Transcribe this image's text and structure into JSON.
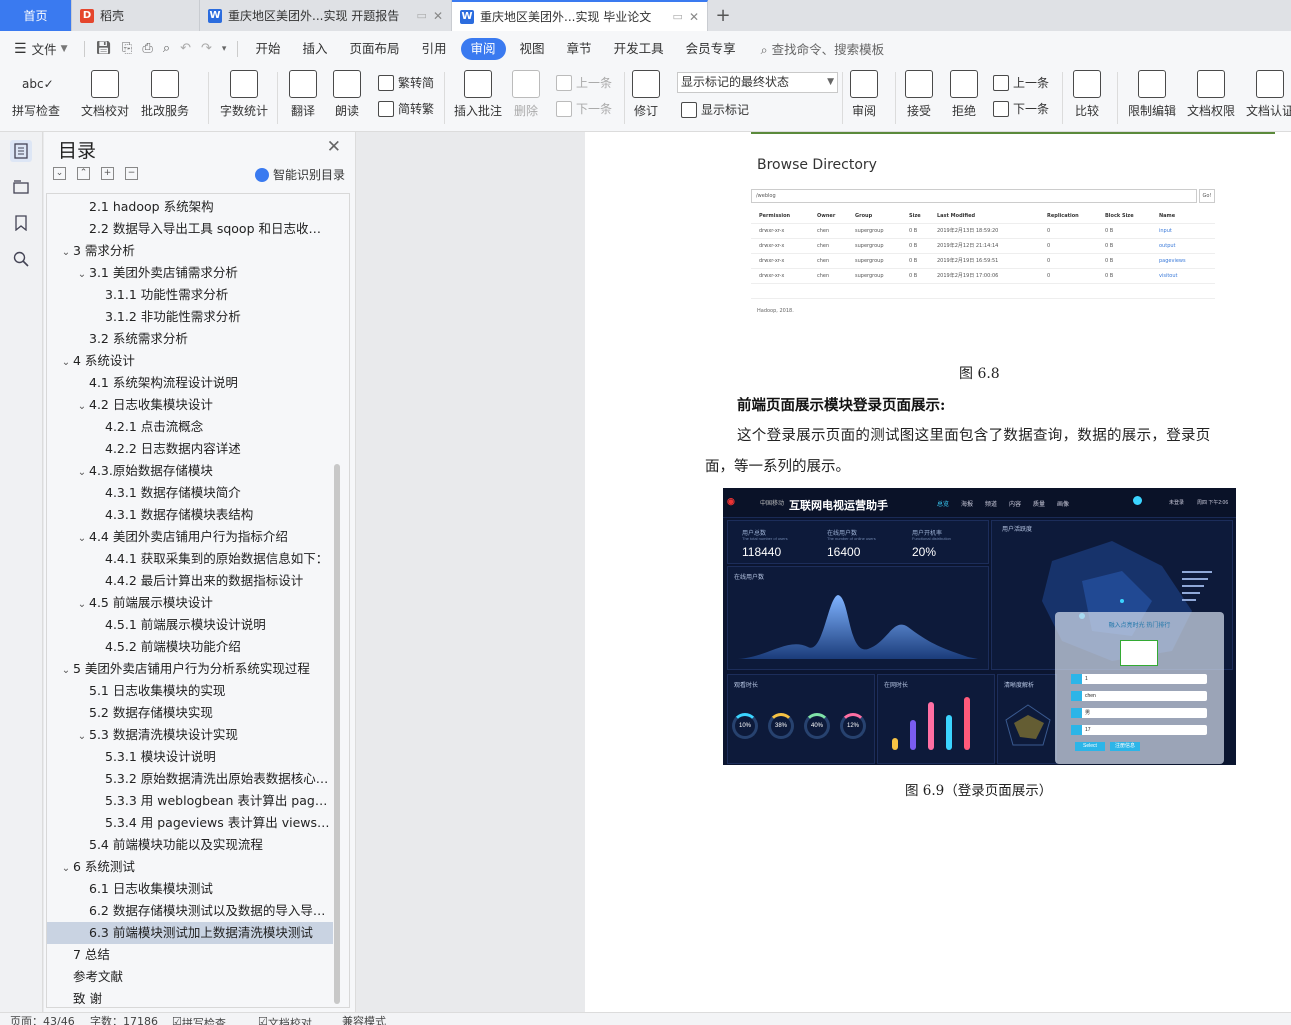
{
  "tabs": {
    "home": "首页",
    "daoke": "稻壳",
    "doc1": "重庆地区美团外...实现 开题报告",
    "doc2": "重庆地区美团外...实现 毕业论文"
  },
  "menu": {
    "file": "文件",
    "items": [
      "开始",
      "插入",
      "页面布局",
      "引用",
      "审阅",
      "视图",
      "章节",
      "开发工具",
      "会员专享"
    ],
    "active": "审阅",
    "search": "查找命令、搜索模板"
  },
  "ribbon": {
    "spell": "拼写检查",
    "doccheck": "文档校对",
    "annotate_service": "批改服务",
    "wordcount": "字数统计",
    "translate": "翻译",
    "read": "朗读",
    "fan2jian": "繁转简",
    "jian2fan": "简转繁",
    "insert_comment": "插入批注",
    "delete": "删除",
    "prev": "上一条",
    "next": "下一条",
    "revise": "修订",
    "markup_select": "显示标记的最终状态",
    "show_markup": "显示标记",
    "review": "审阅",
    "accept": "接受",
    "reject": "拒绝",
    "prev2": "上一条",
    "next2": "下一条",
    "compare": "比较",
    "restrict": "限制编辑",
    "permission": "文档权限",
    "certify": "文档认证"
  },
  "toc": {
    "title": "目录",
    "smart": "智能识别目录",
    "items": [
      {
        "text": "2.1 hadoop 系统架构",
        "level": 2,
        "arrow": ""
      },
      {
        "text": "2.2  数据导入导出工具 sqoop 和日志收集工具 flume",
        "level": 2,
        "arrow": ""
      },
      {
        "text": "3  需求分析",
        "level": 1,
        "arrow": "v"
      },
      {
        "text": "3.1  美团外卖店铺需求分析",
        "level": 2,
        "arrow": "v"
      },
      {
        "text": "3.1.1  功能性需求分析",
        "level": 3,
        "arrow": ""
      },
      {
        "text": "3.1.2  非功能性需求分析",
        "level": 3,
        "arrow": ""
      },
      {
        "text": "3.2  系统需求分析",
        "level": 2,
        "arrow": ""
      },
      {
        "text": "4  系统设计",
        "level": 1,
        "arrow": "v"
      },
      {
        "text": "4.1  系统架构流程设计说明",
        "level": 2,
        "arrow": ""
      },
      {
        "text": "4.2  日志收集模块设计",
        "level": 2,
        "arrow": "v"
      },
      {
        "text": "4.2.1  点击流概念",
        "level": 3,
        "arrow": ""
      },
      {
        "text": "4.2.2  日志数据内容详述",
        "level": 3,
        "arrow": ""
      },
      {
        "text": "4.3.原始数据存储模块",
        "level": 2,
        "arrow": "v"
      },
      {
        "text": "4.3.1 数据存储模块简介",
        "level": 3,
        "arrow": ""
      },
      {
        "text": "4.3.1  数据存储模块表结构",
        "level": 3,
        "arrow": ""
      },
      {
        "text": "4.4  美团外卖店铺用户行为指标介绍",
        "level": 2,
        "arrow": "v"
      },
      {
        "text": "4.4.1  获取采集到的原始数据信息如下：",
        "level": 3,
        "arrow": ""
      },
      {
        "text": "4.4.2  最后计算出来的数据指标设计",
        "level": 3,
        "arrow": ""
      },
      {
        "text": "4.5  前端展示模块设计",
        "level": 2,
        "arrow": "v"
      },
      {
        "text": "4.5.1  前端展示模块设计说明",
        "level": 3,
        "arrow": ""
      },
      {
        "text": "4.5.2  前端模块功能介绍",
        "level": 3,
        "arrow": ""
      },
      {
        "text": "5  美团外卖店铺用户行为分析系统实现过程",
        "level": 1,
        "arrow": "v"
      },
      {
        "text": "5.1  日志收集模块的实现",
        "level": 2,
        "arrow": ""
      },
      {
        "text": "5.2  数据存储模块实现",
        "level": 2,
        "arrow": ""
      },
      {
        "text": "5.3  数据清洗模块设计实现",
        "level": 2,
        "arrow": "v"
      },
      {
        "text": "5.3.1  模块设计说明",
        "level": 3,
        "arrow": ""
      },
      {
        "text": "5.3.2 原始数据清洗出原始表数据核心代码",
        "level": 3,
        "arrow": ""
      },
      {
        "text": "5.3.3  用 weblogbean 表计算出 pageviews 表",
        "level": 3,
        "arrow": ""
      },
      {
        "text": "5.3.4  用 pageviews 表计算出 views 表",
        "level": 3,
        "arrow": ""
      },
      {
        "text": "5.4  前端模块功能以及实现流程",
        "level": 2,
        "arrow": ""
      },
      {
        "text": "6  系统测试",
        "level": 1,
        "arrow": "v"
      },
      {
        "text": "6.1 日志收集模块测试",
        "level": 2,
        "arrow": ""
      },
      {
        "text": "6.2  数据存储模块测试以及数据的导入导出测试",
        "level": 2,
        "arrow": ""
      },
      {
        "text": "6.3  前端模块测试加上数据清洗模块测试",
        "level": 2,
        "arrow": "",
        "selected": true
      },
      {
        "text": "7  总结",
        "level": 1,
        "arrow": ""
      },
      {
        "text": "参考文献",
        "level": 1,
        "arrow": ""
      },
      {
        "text": "致    谢",
        "level": 1,
        "arrow": ""
      }
    ]
  },
  "doc": {
    "hdfs": {
      "title": "Browse Directory",
      "path": "/weblog",
      "go": "Go!",
      "headers": [
        "Permission",
        "Owner",
        "Group",
        "Size",
        "Last Modified",
        "Replication",
        "Block Size",
        "Name"
      ],
      "rows": [
        [
          "drwxr-xr-x",
          "chen",
          "supergroup",
          "0 B",
          "2019年2月13日 18:59:20",
          "0",
          "0 B",
          "input"
        ],
        [
          "drwxr-xr-x",
          "chen",
          "supergroup",
          "0 B",
          "2019年2月12日 21:14:14",
          "0",
          "0 B",
          "output"
        ],
        [
          "drwxr-xr-x",
          "chen",
          "supergroup",
          "0 B",
          "2019年2月19日 16:59:51",
          "0",
          "0 B",
          "pageviews"
        ],
        [
          "drwxr-xr-x",
          "chen",
          "supergroup",
          "0 B",
          "2019年2月19日 17:00:06",
          "0",
          "0 B",
          "visitout"
        ]
      ],
      "footer": "Hadoop, 2018."
    },
    "caption1": "图  6.8",
    "bold_heading": "前端页面展示模块登录页面展示:",
    "para_line1": "这个登录展示页面的测试图这里面包含了数据查询，数据的展示，登录页",
    "para_line2": "面，等一系列的展示。",
    "dashboard": {
      "brand": "中国移动",
      "title": "互联网电视运营助手",
      "nav": [
        "总览",
        "海报",
        "频道",
        "内容",
        "质量",
        "画像"
      ],
      "user": "未登录",
      "time": "周四 下午2:06",
      "kpis": [
        {
          "label": "用户总数",
          "sub": "The total number of users",
          "value": "118440"
        },
        {
          "label": "在线用户数",
          "sub": "The number of online users",
          "value": "16400"
        },
        {
          "label": "用户开机率",
          "sub": "Functional distribution",
          "value": "20%"
        }
      ],
      "active_title": "用户活跃度",
      "online_title": "在线用户数",
      "watch_title": "观看时长",
      "online_time_title": "在网时长",
      "clarity_title": "清晰度解析",
      "rings": [
        "10%",
        "38%",
        "40%",
        "12%"
      ],
      "login_title": "融入点亮时光 热门排行",
      "login_fields": [
        "1",
        "chen",
        "男",
        "17"
      ],
      "login_btn1": "Select",
      "login_btn2": "注册信息"
    },
    "caption2": "图 6.9（登录页面展示）"
  },
  "status": {
    "page": "页面：43/46",
    "words": "字数：17186",
    "spell": "拼写检查",
    "proof": "文档校对",
    "compat": "兼容模式"
  },
  "colors": {
    "accent": "#3a7af0",
    "toc_selected": "#c9d3e2",
    "dash_bg": "#0b1530"
  }
}
